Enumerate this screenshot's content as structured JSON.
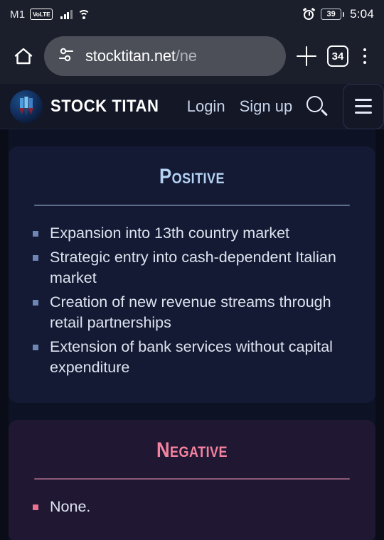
{
  "status_bar": {
    "carrier": "M1",
    "network_badge": "VoLTE",
    "signal_icon": "signal-bars-icon",
    "wifi_icon": "wifi-icon",
    "alarm_icon": "alarm-clock-icon",
    "battery_percent": "39",
    "time": "5:04"
  },
  "browser": {
    "home_icon": "home-icon",
    "site_settings_icon": "tune-icon",
    "url_visible": "stocktitan.net",
    "url_dim": "/ne",
    "new_tab_icon": "plus-icon",
    "tab_count": "34",
    "menu_icon": "kebab-menu-icon"
  },
  "site_header": {
    "logo_icon": "stock-titan-logo-icon",
    "brand": "STOCK TITAN",
    "nav": [
      {
        "label": "Login"
      },
      {
        "label": "Sign up"
      }
    ],
    "search_icon": "search-icon",
    "menu_icon": "hamburger-menu-icon"
  },
  "content": {
    "cards": [
      {
        "title": "Positive",
        "accent": "#b3d2f4",
        "items": [
          "Expansion into 13th country market",
          "Strategic entry into cash-dependent Italian market",
          "Creation of new revenue streams through retail partnerships",
          "Extension of bank services without capital expenditure"
        ]
      },
      {
        "title": "Negative",
        "accent": "#f4829f",
        "items": [
          "None."
        ]
      }
    ]
  }
}
